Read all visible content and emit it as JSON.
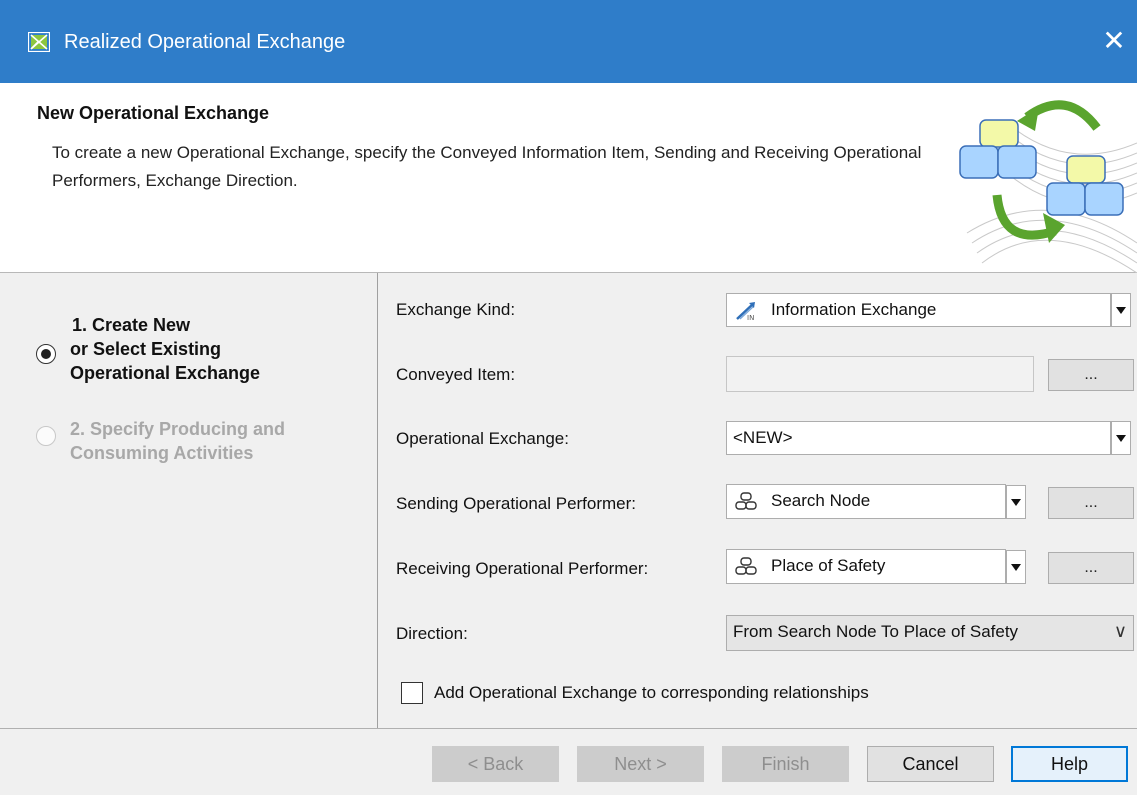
{
  "window": {
    "title": "Realized Operational Exchange",
    "close_symbol": "✕",
    "title_bar_color": "#2f7dc9"
  },
  "header": {
    "title": "New Operational Exchange",
    "description": "To create a new Operational Exchange, specify the Conveyed Information Item, Sending and Receiving Operational Performers, Exchange Direction."
  },
  "steps": [
    {
      "line1": "1. Create New",
      "line2": "or Select Existing",
      "line3": "Operational Exchange",
      "selected": true,
      "enabled": true
    },
    {
      "line1": "2. Specify Producing and",
      "line2": "Consuming Activities",
      "selected": false,
      "enabled": false
    }
  ],
  "form": {
    "exchange_kind": {
      "label": "Exchange Kind:",
      "value": "Information Exchange",
      "icon": "information-exchange-icon"
    },
    "conveyed_item": {
      "label": "Conveyed Item:",
      "value": "",
      "button": "..."
    },
    "operational_exchange": {
      "label": "Operational Exchange:",
      "value": "<NEW>"
    },
    "sending_performer": {
      "label": "Sending Operational Performer:",
      "value": "Search Node",
      "icon": "performer-icon",
      "button": "..."
    },
    "receiving_performer": {
      "label": "Receiving Operational Performer:",
      "value": "Place of Safety",
      "icon": "performer-icon",
      "button": "..."
    },
    "direction": {
      "label": "Direction:",
      "value": "From Search Node To Place of Safety",
      "chevron": "∨"
    },
    "add_to_relationships": {
      "label": "Add Operational Exchange to corresponding relationships",
      "checked": false
    }
  },
  "footer": {
    "back": "< Back",
    "next": "Next >",
    "finish": "Finish",
    "cancel": "Cancel",
    "help": "Help",
    "focus_color": "#0078d7"
  }
}
